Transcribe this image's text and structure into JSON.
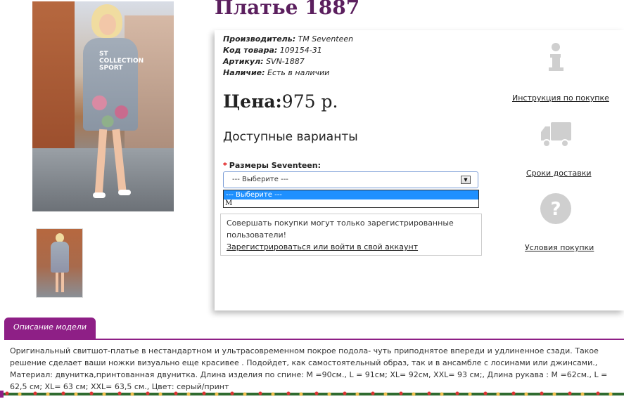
{
  "product": {
    "title": "Платье 1887",
    "manufacturer_label": "Производитель:",
    "manufacturer": "TM Seventeen",
    "code_label": "Код товара:",
    "code": "109154-31",
    "article_label": "Артикул:",
    "article": "SVN-1887",
    "stock_label": "Наличие:",
    "stock": "Есть в наличии",
    "price_label": "Цена:",
    "price_value": "975 р.",
    "variants_heading": "Доступные варианты",
    "size_label": "Размеры Seventeen:",
    "size_required_mark": "*",
    "photo_print": "ST\nCOLLECTION\nSPORT"
  },
  "size_select": {
    "value": "--- Выберите ---",
    "arrow_icon": "chevron-down-icon",
    "options": [
      "--- Выберите ---",
      "M"
    ]
  },
  "notice": {
    "text": "Совершать покупки могут только зарегистрированные пользователи!",
    "link": "Зарегистрироваться или войти в свой аккаунт"
  },
  "side": {
    "items": [
      {
        "icon": "info-icon",
        "label": "Инструкция по покупке"
      },
      {
        "icon": "truck-icon",
        "label": "Сроки доставки"
      },
      {
        "icon": "question-icon",
        "label": "Условия покупки"
      }
    ]
  },
  "description": {
    "tab_label": "Описание модели",
    "text": "Оригинальный свитшот-платье в нестандартном и ультрасовременном покрое подола- чуть приподнятое впереди и удлиненное сзади. Такое решение сделает ваши ножки визуально еще красивее . Подойдет, как самостоятельный образ, так и в ансамбле с лосинами или джинсами., Материал: двунитка,принтованная двунитка. Длина изделия по спине: M =90см., L = 91см; XL= 92см, XXL= 93 см;, Длина рукава : M =62см., L = 62,5 см; XL= 63 см; XXL= 63,5 см., Цвет: серый/принт"
  },
  "colors": {
    "accent": "#8e1f86",
    "title": "#5b1f5e",
    "dropdown_highlight": "#1e90ff",
    "icon_gray": "#cfcfcf"
  }
}
